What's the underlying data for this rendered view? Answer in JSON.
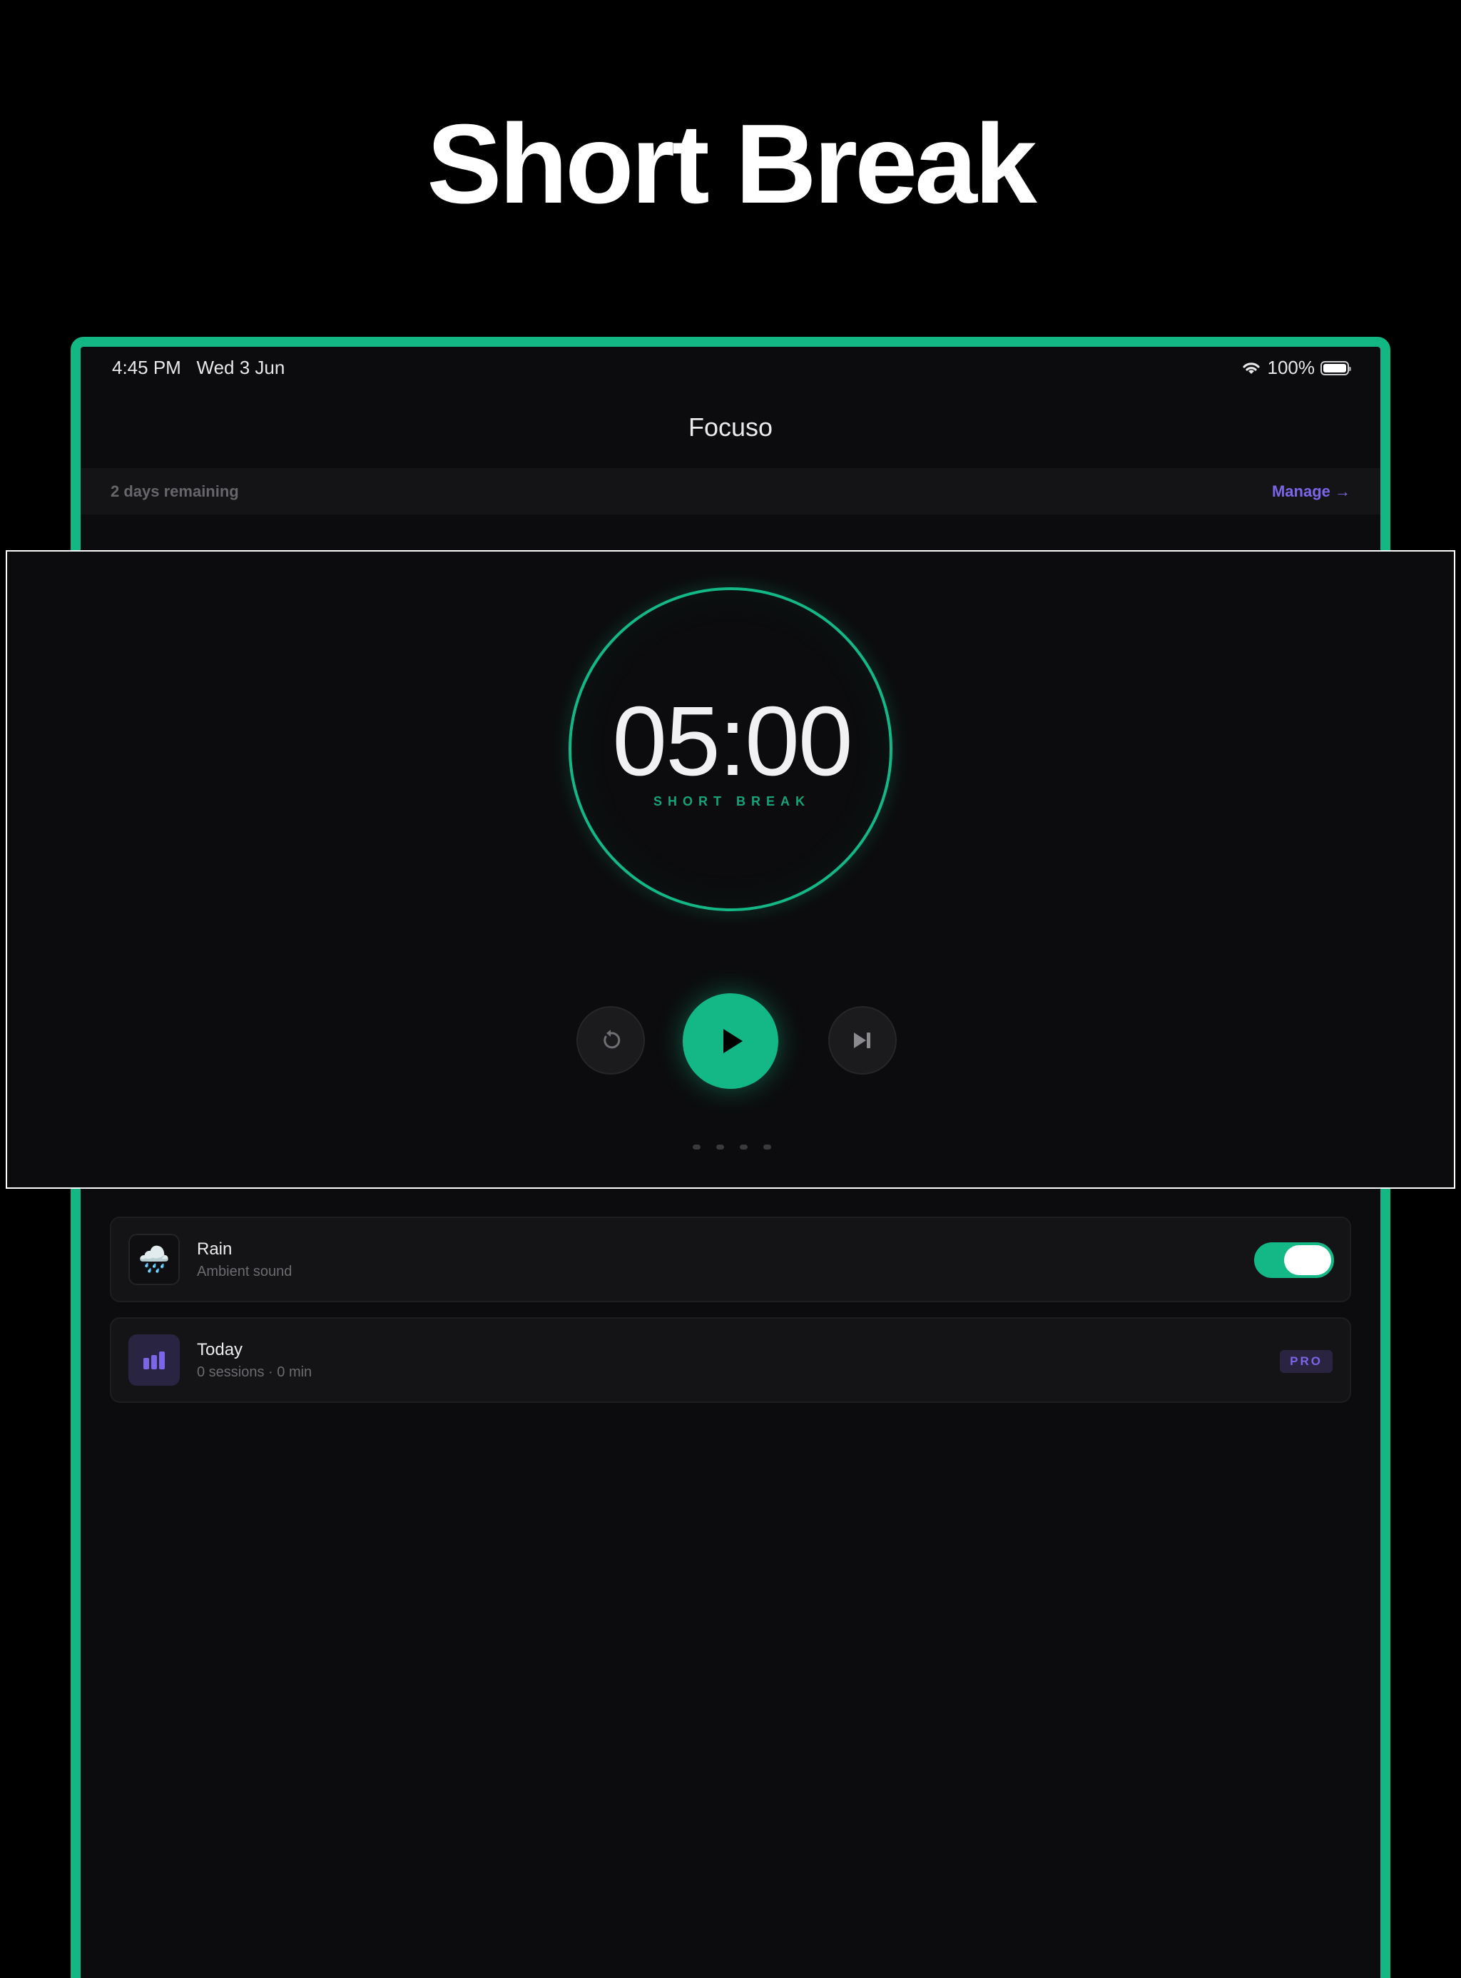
{
  "headline": "Short Break",
  "status_bar": {
    "time": "4:45 PM",
    "date": "Wed 3 Jun",
    "battery": "100%",
    "wifi_icon": "wifi-icon",
    "battery_icon": "battery-icon"
  },
  "nav": {
    "title": "Focuso"
  },
  "trial_banner": {
    "text": "2 days remaining",
    "link": "Manage →"
  },
  "timer": {
    "time": "05:00",
    "mode": "SHORT BREAK",
    "progress": 1.0,
    "controls": [
      "reset-icon",
      "play-icon",
      "skip-icon"
    ],
    "page_count": 4
  },
  "cards": {
    "sound": {
      "icon": "rain-cloud-icon",
      "emoji": "🌧️",
      "title": "Rain",
      "subtitle": "Ambient sound",
      "enabled": true
    },
    "stats": {
      "icon": "bar-chart-icon",
      "title": "Today",
      "subtitle": "0 sessions · 0 min",
      "badge": "PRO"
    }
  },
  "colors": {
    "accent": "#13b783",
    "pro_accent": "#7c66e8",
    "background": "#0c0c0e"
  }
}
